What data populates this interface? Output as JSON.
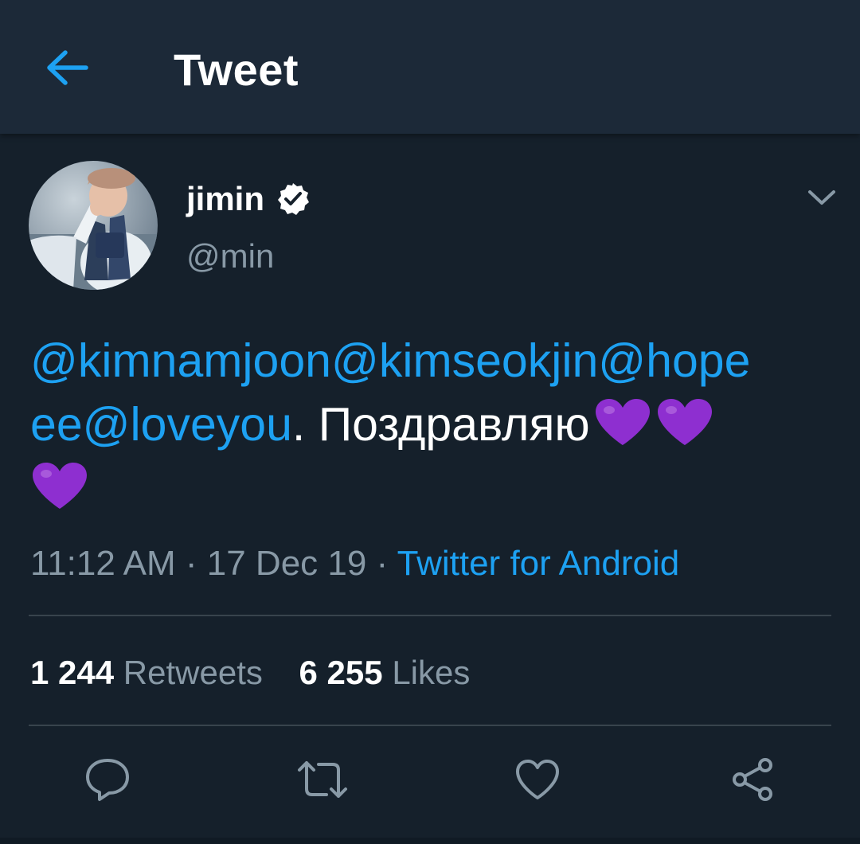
{
  "header": {
    "title": "Tweet",
    "back_icon": "arrow-left-icon"
  },
  "author": {
    "display_name": "jimin",
    "handle": "@min",
    "verified_icon": "verified-badge-icon"
  },
  "tweet": {
    "mentions": [
      "@kimnamjoon",
      "@kimseokjin",
      "@hope",
      "ee",
      "@loveyou"
    ],
    "text_after": ". Поздравляю",
    "emoji": [
      "purple-heart-emoji",
      "purple-heart-emoji",
      "purple-heart-emoji"
    ]
  },
  "meta": {
    "time": "11:12 AM",
    "separator": " · ",
    "date": "17 Dec 19",
    "source": "Twitter for Android"
  },
  "stats": {
    "retweets_count": "1 244",
    "retweets_label": "Retweets",
    "likes_count": "6 255",
    "likes_label": "Likes"
  },
  "actions": [
    "reply-icon",
    "retweet-icon",
    "like-icon",
    "share-icon"
  ],
  "colors": {
    "background": "#15202b",
    "header_bg": "#1c2938",
    "accent": "#1da1f2",
    "secondary_text": "#8899a6",
    "divider": "#38444d",
    "emoji_purple": "#8e2fd0"
  }
}
